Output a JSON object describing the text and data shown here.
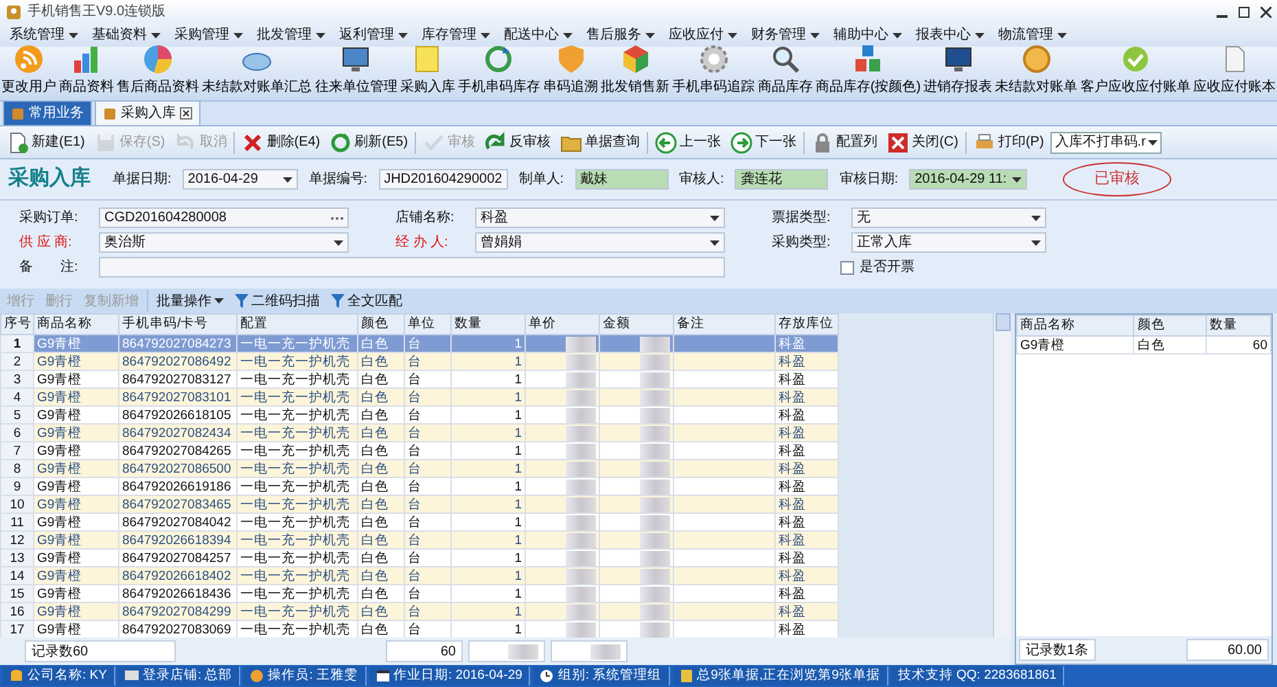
{
  "window": {
    "title": "手机销售王V9.0连锁版"
  },
  "menu": [
    {
      "label": "系统管理",
      "has_dropdown": true
    },
    {
      "label": "基础资料",
      "has_dropdown": true
    },
    {
      "label": "采购管理",
      "has_dropdown": true
    },
    {
      "label": "批发管理",
      "has_dropdown": true
    },
    {
      "label": "返利管理",
      "has_dropdown": true
    },
    {
      "label": "库存管理",
      "has_dropdown": true
    },
    {
      "label": "配送中心",
      "has_dropdown": true
    },
    {
      "label": "售后服务",
      "has_dropdown": true
    },
    {
      "label": "应收应付",
      "has_dropdown": true
    },
    {
      "label": "财务管理",
      "has_dropdown": true
    },
    {
      "label": "辅助中心",
      "has_dropdown": true
    },
    {
      "label": "报表中心",
      "has_dropdown": true
    },
    {
      "label": "物流管理",
      "has_dropdown": true
    }
  ],
  "launcher": [
    "更改用户",
    "商品资料",
    "售后商品资料",
    "未结款对账单汇总",
    "往来单位管理",
    "采购入库",
    "手机串码库存",
    "串码追溯",
    "批发销售新",
    "手机串码追踪",
    "商品库存",
    "商品库存(按颜色)",
    "进销存报表",
    "未结款对账单",
    "客户应收应付账单",
    "应收应付账本"
  ],
  "tabs": [
    {
      "label": "常用业务",
      "selected": false,
      "closable": false
    },
    {
      "label": "采购入库",
      "selected": true,
      "closable": true
    }
  ],
  "toolbar": [
    {
      "label": "新建(E1)",
      "disabled": false
    },
    {
      "label": "保存(S)",
      "disabled": true
    },
    {
      "label": "取消",
      "disabled": true
    },
    {
      "label": "删除(E4)",
      "disabled": false
    },
    {
      "label": "刷新(E5)",
      "disabled": false
    },
    {
      "label": "审核",
      "disabled": true
    },
    {
      "label": "反审核",
      "disabled": false
    },
    {
      "label": "单据查询",
      "disabled": false
    },
    {
      "label": "上一张",
      "disabled": false
    },
    {
      "label": "下一张",
      "disabled": false
    },
    {
      "label": "配置列",
      "disabled": false
    },
    {
      "label": "关闭(C)",
      "disabled": false
    },
    {
      "label": "打印(P)",
      "disabled": false
    }
  ],
  "print_template": "入库不打串码.r",
  "form": {
    "title": "采购入库",
    "status_stamp": "已审核",
    "header_fields": [
      {
        "label": "单据日期:",
        "value": "2016-04-29",
        "kind": "select",
        "highlighted": false
      },
      {
        "label": "单据编号:",
        "value": "JHD201604290002",
        "kind": "text",
        "highlighted": false
      },
      {
        "label": "制单人:",
        "value": "戴妹",
        "kind": "text",
        "highlighted": true
      },
      {
        "label": "审核人:",
        "value": "龚连花",
        "kind": "text",
        "highlighted": true
      },
      {
        "label": "审核日期:",
        "value": "2016-04-29 11:",
        "kind": "select",
        "highlighted": true
      }
    ],
    "fields": [
      {
        "label": "采购订单:",
        "value": "CGD201604280008",
        "kind": "lookup",
        "required": false
      },
      {
        "label": "店铺名称:",
        "value": "科盈",
        "kind": "select",
        "required": false
      },
      {
        "label": "票据类型:",
        "value": "无",
        "kind": "select",
        "required": false
      },
      {
        "label": "供 应 商:",
        "value": "奥治斯",
        "kind": "select",
        "required": true
      },
      {
        "label": "经 办 人:",
        "value": "曾娟娟",
        "kind": "select",
        "required": true
      },
      {
        "label": "采购类型:",
        "value": "正常入库",
        "kind": "select",
        "required": false
      },
      {
        "label": "备　　注:",
        "kind": "note",
        "required": false
      },
      {
        "label": "是否开票",
        "kind": "checkbox",
        "checked": false
      }
    ]
  },
  "grid_toolbar": [
    {
      "label": "增行",
      "disabled": true,
      "kind": "button"
    },
    {
      "label": "删行",
      "disabled": true,
      "kind": "button"
    },
    {
      "label": "复制新增",
      "disabled": true,
      "kind": "button"
    },
    {
      "label": "批量操作",
      "disabled": false,
      "kind": "dropdown"
    },
    {
      "label": "二维码扫描",
      "disabled": false,
      "kind": "filter"
    },
    {
      "label": "全文匹配",
      "disabled": false,
      "kind": "filter"
    }
  ],
  "table": {
    "columns": [
      "序号",
      "商品名称",
      "手机串码/卡号",
      "配置",
      "颜色",
      "单位",
      "数量",
      "单价",
      "金额",
      "备注",
      "存放库位"
    ],
    "rows": [
      {
        "no": "1",
        "name": "G9青橙",
        "serial": "864792027084273",
        "config": "一电一充一护机壳",
        "finish": "白色",
        "unit": "台",
        "qty": "1",
        "location": "科盈",
        "selected": true
      },
      {
        "no": "2",
        "name": "G9青橙",
        "serial": "864792027086492",
        "config": "一电一充一护机壳",
        "finish": "白色",
        "unit": "台",
        "qty": "1",
        "location": "科盈",
        "selected": false
      },
      {
        "no": "3",
        "name": "G9青橙",
        "serial": "864792027083127",
        "config": "一电一充一护机壳",
        "finish": "白色",
        "unit": "台",
        "qty": "1",
        "location": "科盈",
        "selected": false
      },
      {
        "no": "4",
        "name": "G9青橙",
        "serial": "864792027083101",
        "config": "一电一充一护机壳",
        "finish": "白色",
        "unit": "台",
        "qty": "1",
        "location": "科盈",
        "selected": false
      },
      {
        "no": "5",
        "name": "G9青橙",
        "serial": "864792026618105",
        "config": "一电一充一护机壳",
        "finish": "白色",
        "unit": "台",
        "qty": "1",
        "location": "科盈",
        "selected": false
      },
      {
        "no": "6",
        "name": "G9青橙",
        "serial": "864792027082434",
        "config": "一电一充一护机壳",
        "finish": "白色",
        "unit": "台",
        "qty": "1",
        "location": "科盈",
        "selected": false
      },
      {
        "no": "7",
        "name": "G9青橙",
        "serial": "864792027084265",
        "config": "一电一充一护机壳",
        "finish": "白色",
        "unit": "台",
        "qty": "1",
        "location": "科盈",
        "selected": false
      },
      {
        "no": "8",
        "name": "G9青橙",
        "serial": "864792027086500",
        "config": "一电一充一护机壳",
        "finish": "白色",
        "unit": "台",
        "qty": "1",
        "location": "科盈",
        "selected": false
      },
      {
        "no": "9",
        "name": "G9青橙",
        "serial": "864792026619186",
        "config": "一电一充一护机壳",
        "finish": "白色",
        "unit": "台",
        "qty": "1",
        "location": "科盈",
        "selected": false
      },
      {
        "no": "10",
        "name": "G9青橙",
        "serial": "864792027083465",
        "config": "一电一充一护机壳",
        "finish": "白色",
        "unit": "台",
        "qty": "1",
        "location": "科盈",
        "selected": false
      },
      {
        "no": "11",
        "name": "G9青橙",
        "serial": "864792027084042",
        "config": "一电一充一护机壳",
        "finish": "白色",
        "unit": "台",
        "qty": "1",
        "location": "科盈",
        "selected": false
      },
      {
        "no": "12",
        "name": "G9青橙",
        "serial": "864792026618394",
        "config": "一电一充一护机壳",
        "finish": "白色",
        "unit": "台",
        "qty": "1",
        "location": "科盈",
        "selected": false
      },
      {
        "no": "13",
        "name": "G9青橙",
        "serial": "864792027084257",
        "config": "一电一充一护机壳",
        "finish": "白色",
        "unit": "台",
        "qty": "1",
        "location": "科盈",
        "selected": false
      },
      {
        "no": "14",
        "name": "G9青橙",
        "serial": "864792026618402",
        "config": "一电一充一护机壳",
        "finish": "白色",
        "unit": "台",
        "qty": "1",
        "location": "科盈",
        "selected": false
      },
      {
        "no": "15",
        "name": "G9青橙",
        "serial": "864792026618436",
        "config": "一电一充一护机壳",
        "finish": "白色",
        "unit": "台",
        "qty": "1",
        "location": "科盈",
        "selected": false
      },
      {
        "no": "16",
        "name": "G9青橙",
        "serial": "864792027084299",
        "config": "一电一充一护机壳",
        "finish": "白色",
        "unit": "台",
        "qty": "1",
        "location": "科盈",
        "selected": false
      },
      {
        "no": "17",
        "name": "G9青橙",
        "serial": "864792027083069",
        "config": "一电一充一护机壳",
        "finish": "白色",
        "unit": "台",
        "qty": "1",
        "location": "科盈",
        "selected": false
      }
    ],
    "footer": {
      "count": "记录数60",
      "qty_total": "60"
    }
  },
  "summary": {
    "columns": [
      "商品名称",
      "颜色",
      "数量"
    ],
    "rows": [
      {
        "name": "G9青橙",
        "finish": "白色",
        "qty": "60"
      }
    ],
    "footer": {
      "count": "记录数1条",
      "total": "60.00"
    }
  },
  "status_bar": [
    "公司名称: KY",
    "登录店铺: 总部",
    "操作员: 王雅雯",
    "作业日期: 2016-04-29",
    "组别: 系统管理组",
    "总9张单据,正在浏览第9张单据",
    "技术支持 QQ: 2283681861"
  ]
}
